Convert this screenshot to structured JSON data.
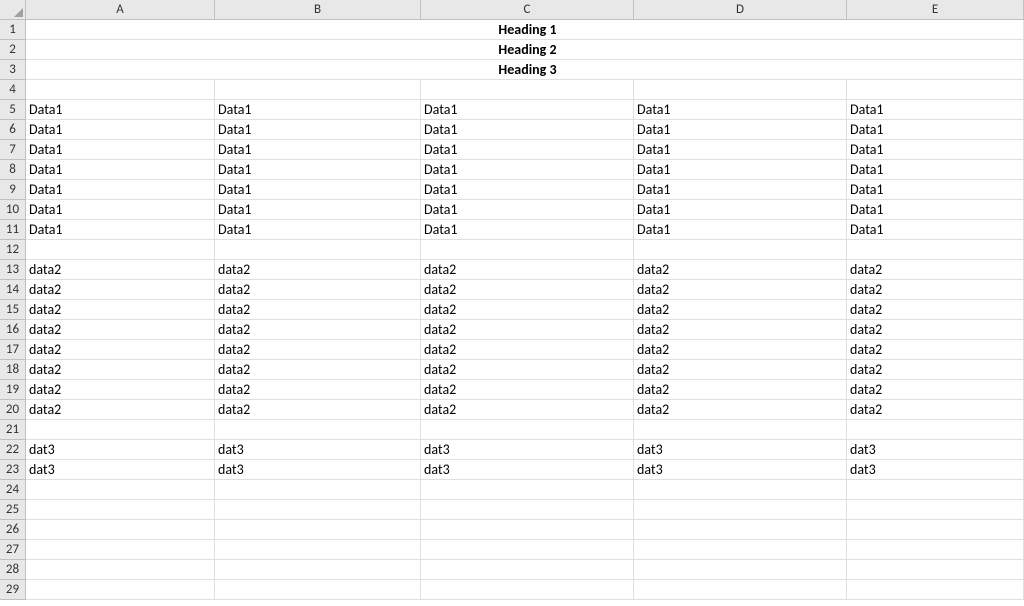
{
  "columns": [
    "A",
    "B",
    "C",
    "D",
    "E"
  ],
  "rowCount": 29,
  "headings": {
    "1": "Heading 1",
    "2": "Heading 2",
    "3": "Heading 3"
  },
  "dataRows": {
    "5": [
      "Data1",
      "Data1",
      "Data1",
      "Data1",
      "Data1"
    ],
    "6": [
      "Data1",
      "Data1",
      "Data1",
      "Data1",
      "Data1"
    ],
    "7": [
      "Data1",
      "Data1",
      "Data1",
      "Data1",
      "Data1"
    ],
    "8": [
      "Data1",
      "Data1",
      "Data1",
      "Data1",
      "Data1"
    ],
    "9": [
      "Data1",
      "Data1",
      "Data1",
      "Data1",
      "Data1"
    ],
    "10": [
      "Data1",
      "Data1",
      "Data1",
      "Data1",
      "Data1"
    ],
    "11": [
      "Data1",
      "Data1",
      "Data1",
      "Data1",
      "Data1"
    ],
    "13": [
      "data2",
      "data2",
      "data2",
      "data2",
      "data2"
    ],
    "14": [
      "data2",
      "data2",
      "data2",
      "data2",
      "data2"
    ],
    "15": [
      "data2",
      "data2",
      "data2",
      "data2",
      "data2"
    ],
    "16": [
      "data2",
      "data2",
      "data2",
      "data2",
      "data2"
    ],
    "17": [
      "data2",
      "data2",
      "data2",
      "data2",
      "data2"
    ],
    "18": [
      "data2",
      "data2",
      "data2",
      "data2",
      "data2"
    ],
    "19": [
      "data2",
      "data2",
      "data2",
      "data2",
      "data2"
    ],
    "20": [
      "data2",
      "data2",
      "data2",
      "data2",
      "data2"
    ],
    "22": [
      "dat3",
      "dat3",
      "dat3",
      "dat3",
      "dat3"
    ],
    "23": [
      "dat3",
      "dat3",
      "dat3",
      "dat3",
      "dat3"
    ]
  }
}
